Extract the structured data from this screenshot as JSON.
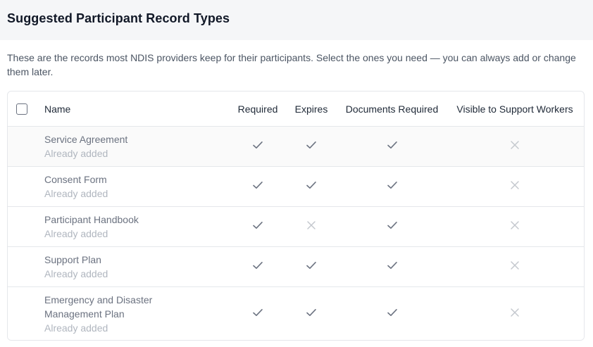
{
  "header": {
    "title": "Suggested Participant Record Types"
  },
  "description": "These are the records most NDIS providers keep for their participants. Select the ones you need — you can always add or change them later.",
  "table": {
    "columns": {
      "name": "Name",
      "required": "Required",
      "expires": "Expires",
      "documents_required": "Documents Required",
      "visible": "Visible to Support Workers"
    },
    "rows": [
      {
        "name": "Service Agreement",
        "status": "Already added",
        "required": true,
        "expires": true,
        "documents_required": true,
        "visible": false
      },
      {
        "name": "Consent Form",
        "status": "Already added",
        "required": true,
        "expires": true,
        "documents_required": true,
        "visible": false
      },
      {
        "name": "Participant Handbook",
        "status": "Already added",
        "required": true,
        "expires": false,
        "documents_required": true,
        "visible": false
      },
      {
        "name": "Support Plan",
        "status": "Already added",
        "required": true,
        "expires": true,
        "documents_required": true,
        "visible": false
      },
      {
        "name": "Emergency and Disaster Management Plan",
        "status": "Already added",
        "required": true,
        "expires": true,
        "documents_required": true,
        "visible": false
      }
    ]
  },
  "icons": {
    "yes": "check-icon",
    "no": "x-icon"
  },
  "colors": {
    "check": "#6b7280",
    "x": "#c4c8ce",
    "header_bg": "#f5f6f8",
    "border": "#e5e7eb"
  }
}
